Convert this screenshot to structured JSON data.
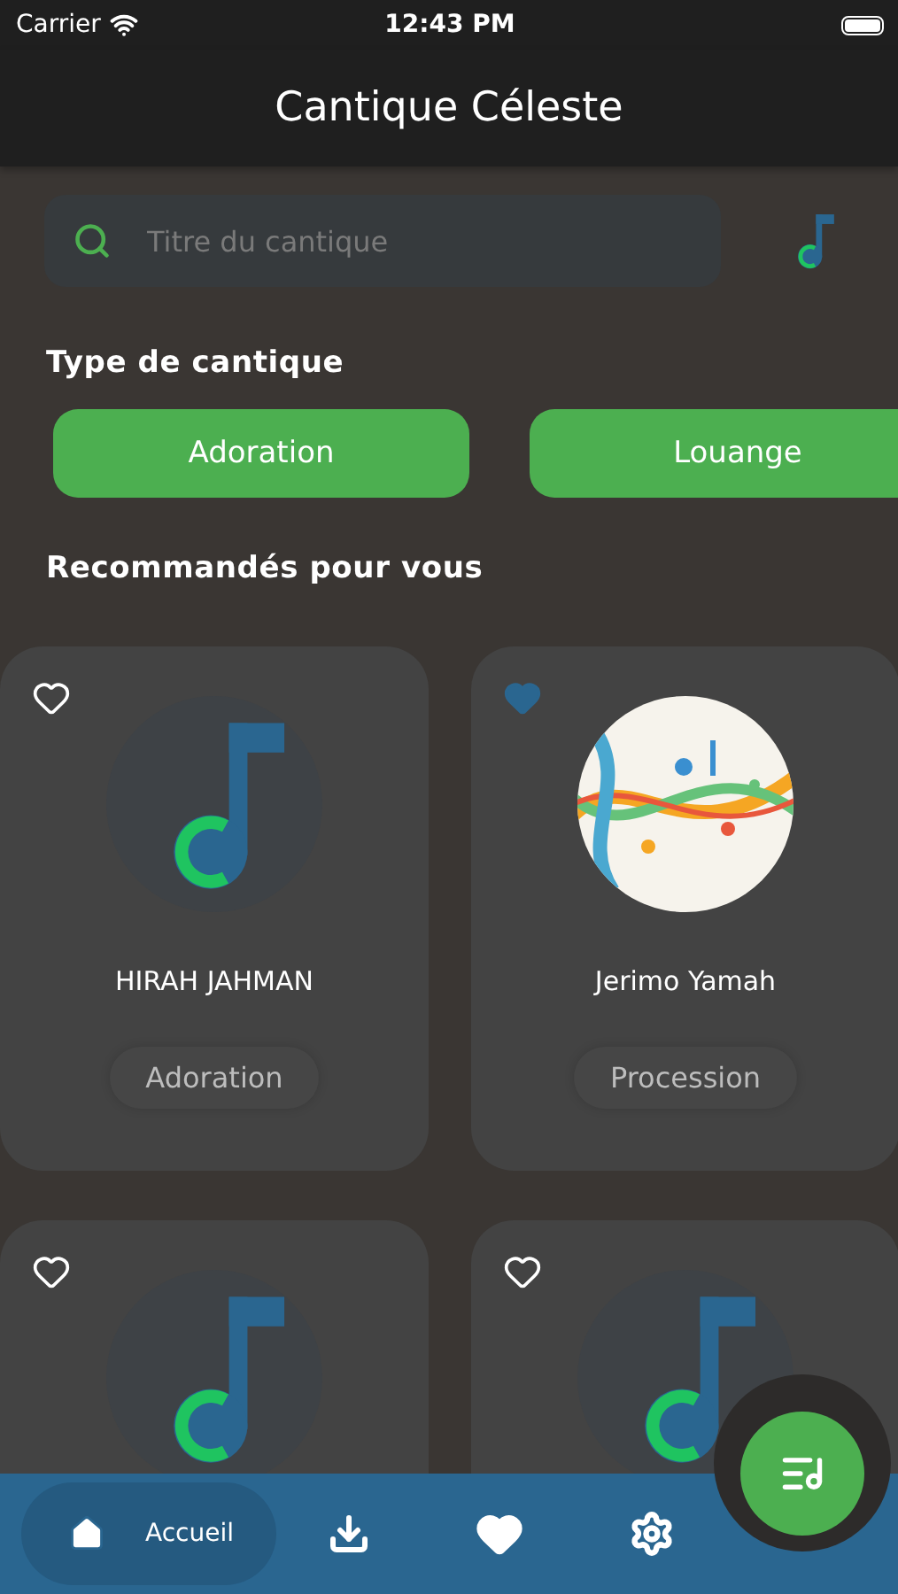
{
  "status_bar": {
    "carrier": "Carrier",
    "time": "12:43 PM"
  },
  "header": {
    "title": "Cantique Céleste"
  },
  "search": {
    "placeholder": "Titre du cantique"
  },
  "categories": {
    "heading": "Type de cantique",
    "items": [
      {
        "label": "Adoration"
      },
      {
        "label": "Louange"
      }
    ]
  },
  "recommended": {
    "heading": "Recommandés pour vous",
    "cards": [
      {
        "name": "HIRAH JAHMAN",
        "tag": "Adoration",
        "liked": false,
        "kind": "logo"
      },
      {
        "name": "Jerimo Yamah",
        "tag": "Procession",
        "liked": true,
        "kind": "picture"
      },
      {
        "liked": false,
        "kind": "logo"
      },
      {
        "liked": false,
        "kind": "logo"
      }
    ]
  },
  "bottom_nav": [
    {
      "kind": "home",
      "label": "Accueil",
      "selected": true
    },
    {
      "kind": "download",
      "selected": false
    },
    {
      "kind": "favorites",
      "selected": false
    },
    {
      "kind": "settings",
      "selected": false
    }
  ]
}
